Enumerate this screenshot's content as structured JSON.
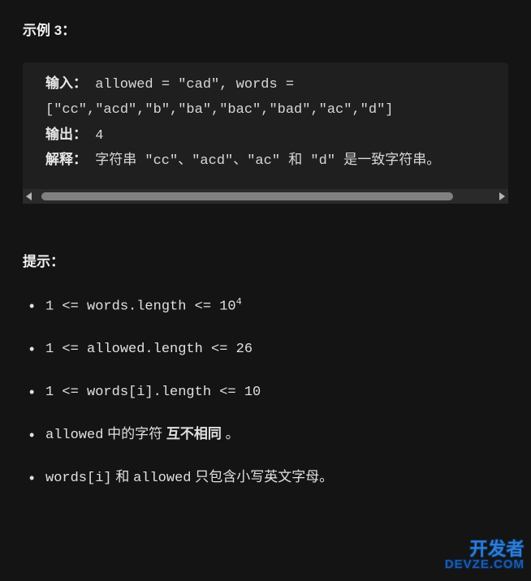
{
  "example": {
    "heading": "示例 3：",
    "input_label": "输入：",
    "input_value": "allowed = \"cad\", words = [\"cc\",\"acd\",\"b\",\"ba\",\"bac\",\"bad\",\"ac\",\"d\"]",
    "output_label": "输出：",
    "output_value": "4",
    "explain_label": "解释：",
    "explain_value": "字符串 \"cc\"、\"acd\"、\"ac\" 和 \"d\" 是一致字符串。"
  },
  "hints": {
    "heading": "提示：",
    "items": [
      {
        "pre": "1 <= words.length <= 10",
        "sup": "4",
        "post": ""
      },
      {
        "pre": "1 <= allowed.length <= 26",
        "sup": "",
        "post": ""
      },
      {
        "pre": "1 <= words[i].length <= 10",
        "sup": "",
        "post": ""
      },
      {
        "pre": "allowed",
        "sup": "",
        "mid": " 中的字符 ",
        "bold": "互不相同",
        "post": " 。"
      },
      {
        "pre": "words[i]",
        "sup": "",
        "mid": " 和 ",
        "pre2": "allowed",
        "post": " 只包含小写英文字母。"
      }
    ]
  },
  "watermark": {
    "top": "开发者",
    "bottom": "DEVZE.COM"
  }
}
